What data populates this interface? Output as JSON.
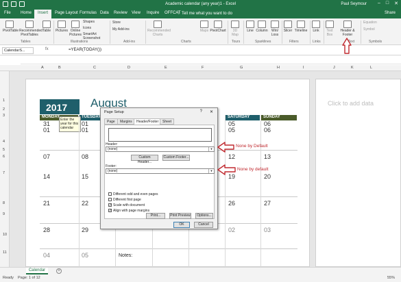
{
  "titlebar": {
    "title": "Academic calendar (any year)1 - Excel",
    "user": "Paul Seymour",
    "controls": [
      "–",
      "□",
      "✕"
    ]
  },
  "tabs": [
    "File",
    "Home",
    "Insert",
    "Page Layout",
    "Formulas",
    "Data",
    "Review",
    "View",
    "Inquire",
    "OFFCAT"
  ],
  "active_tab": "Insert",
  "tell_me": "♡ Tell me what you want to do",
  "share": "Share",
  "ribbon": {
    "buttons": {
      "pivottable": "PivotTable",
      "recommended_pivot": "Recommended PivotTables",
      "table": "Table",
      "pictures": "Pictures",
      "online_pictures": "Online Pictures",
      "shapes": "Shapes",
      "icons": "Icons",
      "smartart": "SmartArt",
      "screenshot": "Screenshot",
      "store": "Store",
      "my_addins": "My Add-ins",
      "recommended_charts": "Recommended Charts",
      "maps": "Maps",
      "pivotchart": "PivotChart",
      "map3d": "3D Map",
      "line": "Line",
      "column": "Column",
      "winloss": "Win/ Loss",
      "slicer": "Slicer",
      "timeline": "Timeline",
      "link": "Link",
      "textbox": "Text Box",
      "header_footer": "Header & Footer",
      "equation": "Equation",
      "symbol": "Symbol"
    },
    "groups": {
      "tables": "Tables",
      "illustrations": "Illustrations",
      "addins": "Add-ins",
      "charts": "Charts",
      "tours": "Tours",
      "sparklines": "Sparklines",
      "filters": "Filters",
      "links": "Links",
      "text": "Text",
      "symbols": "Symbols"
    }
  },
  "formula_bar": {
    "name_box": "CalendarS...",
    "fx": "fx",
    "formula": "=YEAR(TODAY())"
  },
  "columns": [
    "A",
    "B",
    "C",
    "D",
    "E",
    "F",
    "G",
    "H",
    "I",
    "J",
    "K",
    "L"
  ],
  "rows": [
    "1",
    "2",
    "3",
    "4",
    "5",
    "6",
    "7",
    "8",
    "9",
    "10",
    "11"
  ],
  "calendar": {
    "year": "2017",
    "month": "August",
    "days": [
      "MONDAY",
      "TUESDAY",
      "SATURDAY",
      "SUNDAY"
    ],
    "week_rows": [
      {
        "mon": "31",
        "mon2": "01",
        "tue": "01",
        "tue2": "01",
        "sat": "05",
        "sat2": "05",
        "sun": "06",
        "sun2": "06"
      },
      {
        "mon": "07",
        "tue": "08",
        "sat": "12",
        "sun": "13"
      },
      {
        "mon": "14",
        "tue": "15",
        "sat": "19",
        "sun": "20"
      },
      {
        "mon": "21",
        "tue": "22",
        "sat": "26",
        "sun": "27"
      },
      {
        "mon": "28",
        "tue": "29",
        "sat": "02",
        "sun": "03"
      },
      {
        "mon": "04",
        "tue": "05"
      }
    ],
    "notes_label": "Notes:",
    "tooltip": "Enter the year for this calendar"
  },
  "click_to_add": "Click to add data",
  "dialog": {
    "title": "Page Setup",
    "help": "?",
    "close": "✕",
    "tabs": [
      "Page",
      "Margins",
      "Header/Footer",
      "Sheet"
    ],
    "active_tab": "Header/Footer",
    "header_label": "Header:",
    "header_value": "(none)",
    "custom_header": "Custom Header...",
    "custom_footer": "Custom Footer...",
    "footer_label": "Footer:",
    "footer_value": "(none)",
    "checkboxes": [
      {
        "label": "Different odd and even pages",
        "checked": false
      },
      {
        "label": "Different first page",
        "checked": false
      },
      {
        "label": "Scale with document",
        "checked": true
      },
      {
        "label": "Align with page margins",
        "checked": true
      }
    ],
    "print": "Print...",
    "print_preview": "Print Preview",
    "options": "Options...",
    "ok": "OK",
    "cancel": "Cancel"
  },
  "annotations": {
    "header_note": "None by Default",
    "footer_note": "None by default",
    "color": "#c0282e"
  },
  "sheet_tab": "Calendar",
  "status": {
    "ready": "Ready",
    "page": "Page: 1 of 12",
    "zoom": "55%"
  },
  "colors": {
    "excel_green": "#217346",
    "calendar_teal": "#1f5f6b",
    "calendar_olive": "#4a5b2a"
  }
}
